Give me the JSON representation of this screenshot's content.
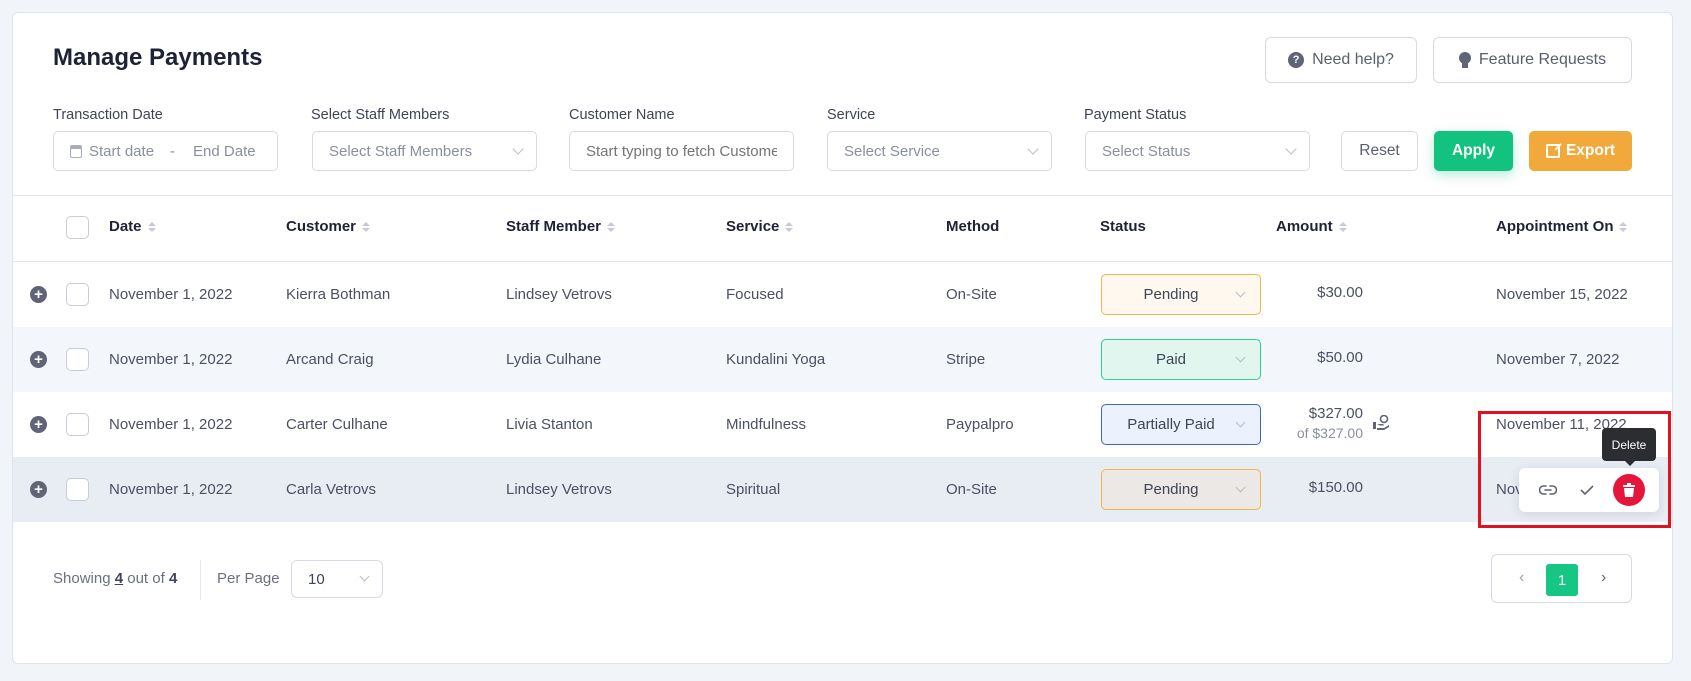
{
  "header": {
    "title": "Manage Payments",
    "need_help_label": "Need help?",
    "feature_requests_label": "Feature Requests"
  },
  "filters": {
    "transaction_date": {
      "label": "Transaction Date",
      "start_placeholder": "Start date",
      "separator": "-",
      "end_placeholder": "End Date"
    },
    "staff": {
      "label": "Select Staff Members",
      "placeholder": "Select Staff Members"
    },
    "customer": {
      "label": "Customer Name",
      "placeholder": "Start typing to fetch Customers"
    },
    "service": {
      "label": "Service",
      "placeholder": "Select Service"
    },
    "payment_status": {
      "label": "Payment Status",
      "placeholder": "Select Status"
    },
    "reset_label": "Reset",
    "apply_label": "Apply",
    "export_label": "Export"
  },
  "table": {
    "columns": [
      "Date",
      "Customer",
      "Staff Member",
      "Service",
      "Method",
      "Status",
      "Amount",
      "Appointment On"
    ],
    "rows": [
      {
        "date": "November 1, 2022",
        "customer": "Kierra Bothman",
        "staff": "Lindsey Vetrovs",
        "service": "Focused",
        "method": "On-Site",
        "status": "Pending",
        "amount": "$30.00",
        "appointment": "November 15, 2022"
      },
      {
        "date": "November 1, 2022",
        "customer": "Arcand Craig",
        "staff": "Lydia Culhane",
        "service": "Kundalini Yoga",
        "method": "Stripe",
        "status": "Paid",
        "amount": "$50.00",
        "appointment": "November 7, 2022"
      },
      {
        "date": "November 1, 2022",
        "customer": "Carter Culhane",
        "staff": "Livia Stanton",
        "service": "Mindfulness",
        "method": "Paypalpro",
        "status": "Partially Paid",
        "amount": "$327.00",
        "amount_sub": "of $327.00",
        "appointment": "November 11, 2022"
      },
      {
        "date": "November 1, 2022",
        "customer": "Carla Vetrovs",
        "staff": "Lindsey Vetrovs",
        "service": "Spiritual",
        "method": "On-Site",
        "status": "Pending",
        "amount": "$150.00",
        "appointment": "Nov"
      }
    ]
  },
  "row_actions": {
    "icons": [
      "link-icon",
      "check-icon",
      "trash-icon"
    ],
    "tooltip": "Delete"
  },
  "footer": {
    "showing_prefix": "Showing",
    "showing_count": "4",
    "showing_mid": "out of",
    "showing_total": "4",
    "per_page_label": "Per Page",
    "per_page_value": "10",
    "prev": "‹",
    "current_page": "1",
    "next": "›"
  },
  "colors": {
    "apply": "#12c27e",
    "export": "#f2a93b",
    "pending_border": "#f2b54a",
    "paid_border": "#2fcf93",
    "partial_border": "#3d68b8",
    "delete": "#e5153b",
    "highlight": "#e0121f"
  }
}
